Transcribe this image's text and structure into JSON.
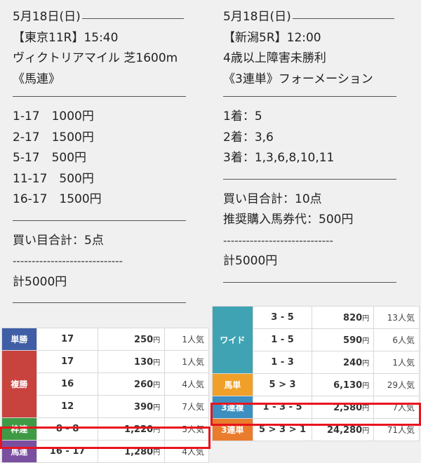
{
  "left": {
    "date": "5月18日(日)",
    "race": "【東京11R】15:40",
    "name": "ヴィクトリアマイル 芝1600m",
    "bet_type": "《馬連》",
    "bets": [
      "1-17　1000円",
      "2-17　1500円",
      "5-17　500円",
      "11-17　500円",
      "16-17　1500円"
    ],
    "total_points": "買い目合計：5点",
    "dashes": "-----------------------------",
    "total_amount": "計5000円"
  },
  "right": {
    "date": "5月18日(日)",
    "race": "【新潟5R】12:00",
    "name": "4歳以上障害未勝利",
    "bet_type": "《3連単》フォーメーション",
    "bets": [
      "1着：5",
      "2着：3,6",
      "3着：1,3,6,8,10,11"
    ],
    "total_points": "買い目合計：10点",
    "recommended": "推奨購入馬券代：500円",
    "dashes": "-----------------------------",
    "total_amount": "計5000円"
  },
  "left_results": {
    "tansho": {
      "type": "単勝",
      "num": "17",
      "pay": "250",
      "pop": "1人気"
    },
    "fukusho": {
      "type": "複勝",
      "rows": [
        {
          "num": "17",
          "pay": "130",
          "pop": "1人気"
        },
        {
          "num": "16",
          "pay": "260",
          "pop": "4人気"
        },
        {
          "num": "12",
          "pay": "390",
          "pop": "7人気"
        }
      ]
    },
    "wakuren": {
      "type": "枠連",
      "num": "8 - 8",
      "pay": "1,220",
      "pop": "5人気"
    },
    "umaren": {
      "type": "馬連",
      "num": "16 - 17",
      "pay": "1,280",
      "pop": "4人気"
    }
  },
  "right_results": {
    "wide": {
      "type": "ワイド",
      "rows": [
        {
          "num": "3 - 5",
          "pay": "820",
          "pop": "13人気"
        },
        {
          "num": "1 - 5",
          "pay": "590",
          "pop": "6人気"
        },
        {
          "num": "1 - 3",
          "pay": "240",
          "pop": "1人気"
        }
      ]
    },
    "umatan": {
      "type": "馬単",
      "num": "5 > 3",
      "pay": "6,130",
      "pop": "29人気"
    },
    "sanrenpuku": {
      "type": "3連複",
      "num": "1 - 3 - 5",
      "pay": "2,580",
      "pop": "7人気"
    },
    "sanrentan": {
      "type": "3連単",
      "num": "5 > 3 > 1",
      "pay": "24,280",
      "pop": "71人気"
    }
  },
  "yen": "円",
  "colors": {
    "highlight": "#e8141e"
  }
}
